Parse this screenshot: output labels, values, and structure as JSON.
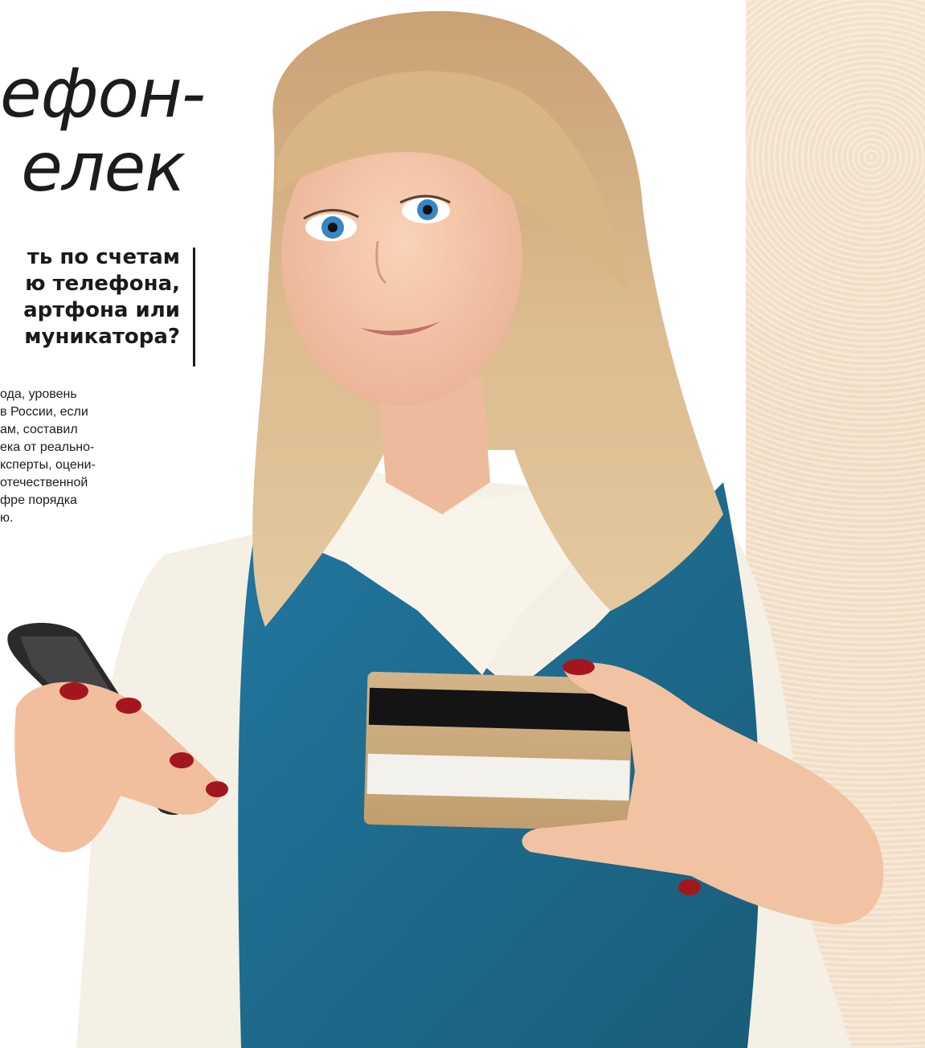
{
  "article": {
    "headline": [
      "ефон-",
      "елек"
    ],
    "subheading": [
      "ть по счетам",
      "ю телефона,",
      "артфона или",
      "муникатора?"
    ],
    "body": [
      "ода, уровень",
      "в России, если",
      "ам, составил",
      "ека от реально-",
      "ксперты, оцени-",
      "отечественной",
      "фре порядка",
      "ю."
    ]
  },
  "photo": {
    "subject": "woman-holding-phone-and-card",
    "colors": {
      "vest": "#1e6a86",
      "shirt": "#f6f1e6",
      "hair": "#d7b488",
      "skin": "#f3c2a4",
      "card_gold": "#c9a77a",
      "nails": "#a4161d"
    }
  }
}
